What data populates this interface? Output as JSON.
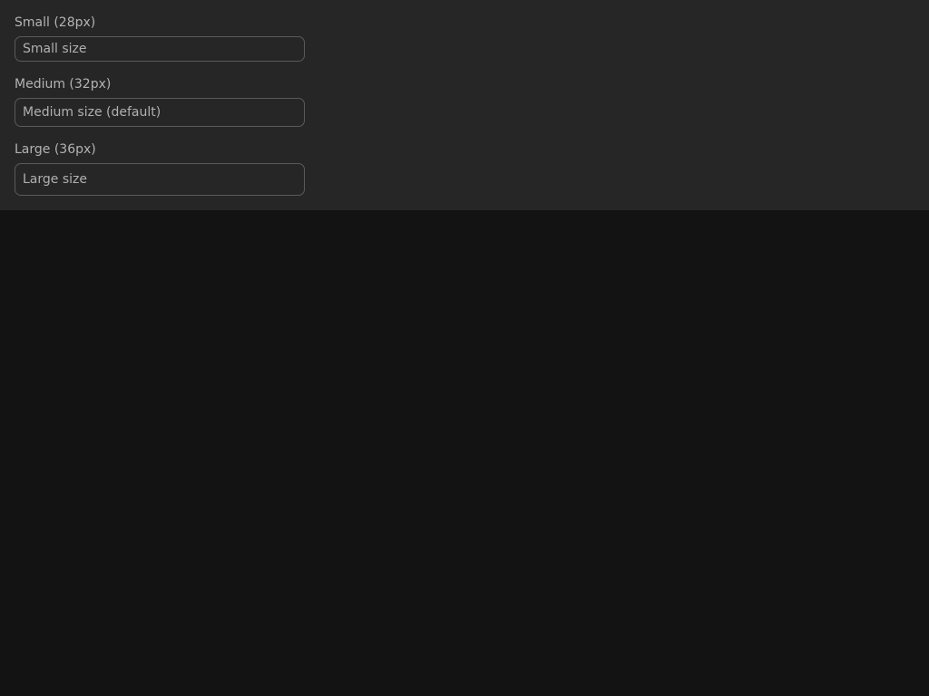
{
  "fields": [
    {
      "label": "Small (28px)",
      "placeholder": "Small size"
    },
    {
      "label": "Medium (32px)",
      "placeholder": "Medium size (default)"
    },
    {
      "label": "Large (36px)",
      "placeholder": "Large size"
    }
  ],
  "colors": {
    "page_background": "#131313",
    "panel_background": "#262626",
    "input_border": "#5a5a5a",
    "label_text": "#b3b3b3",
    "placeholder_text": "#b0b0b0"
  }
}
